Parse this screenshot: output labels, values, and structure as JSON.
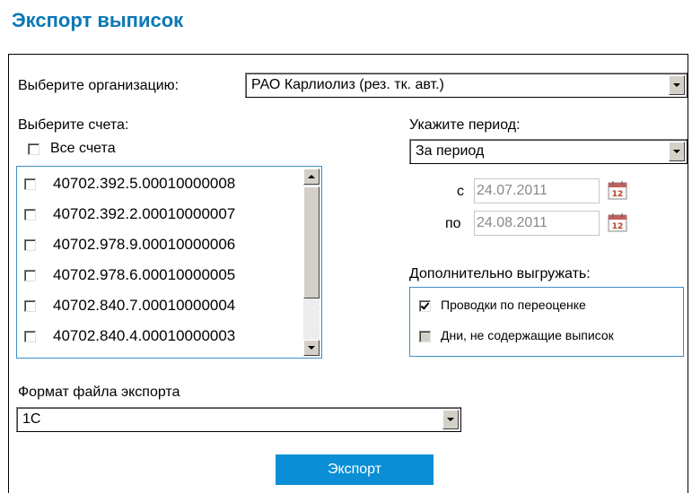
{
  "title": "Экспорт выписок",
  "org": {
    "label": "Выберите организацию:",
    "value": "РАО Карлиолиз (рез. тк. авт.)"
  },
  "accounts": {
    "label": "Выберите счета:",
    "all_label": "Все счета",
    "items": [
      "40702.392.5.00010000008",
      "40702.392.2.00010000007",
      "40702.978.9.00010000006",
      "40702.978.6.00010000005",
      "40702.840.7.00010000004",
      "40702.840.4.00010000003"
    ]
  },
  "period": {
    "label": "Укажите период:",
    "value": "За период",
    "from_label": "с",
    "from_value": "24.07.2011",
    "to_label": "по",
    "to_value": "24.08.2011",
    "calendar_day": "12"
  },
  "extra": {
    "label": "Дополнительно выгружать:",
    "options": [
      {
        "label": "Проводки по переоценке",
        "checked": true,
        "enabled": true
      },
      {
        "label": "Дни, не содержащие выписок",
        "checked": false,
        "enabled": false
      }
    ]
  },
  "format": {
    "label": "Формат файла экспорта",
    "value": "1С"
  },
  "export_button": "Экспорт",
  "colors": {
    "accent": "#0a8fd6",
    "title": "#0a78b5",
    "box_border": "#3d8ec9"
  }
}
